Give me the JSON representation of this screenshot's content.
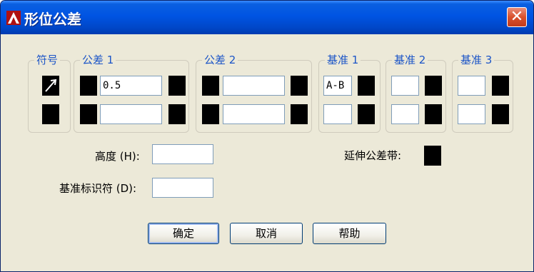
{
  "window": {
    "title": "形位公差",
    "close_glyph": "✕"
  },
  "groups": {
    "symbol": {
      "label": "符号"
    },
    "tol1": {
      "label": "公差 1",
      "row1_value": "0.5",
      "row2_value": ""
    },
    "tol2": {
      "label": "公差 2",
      "row1_value": "",
      "row2_value": ""
    },
    "datum1": {
      "label": "基准 1",
      "row1_value": "A-B",
      "row2_value": ""
    },
    "datum2": {
      "label": "基准 2",
      "row1_value": "",
      "row2_value": ""
    },
    "datum3": {
      "label": "基准 3",
      "row1_value": "",
      "row2_value": ""
    }
  },
  "fields": {
    "height_label": "高度 (H):",
    "height_value": "",
    "datum_id_label": "基准标识符 (D):",
    "datum_id_value": "",
    "projected_zone_label": "延伸公差带:"
  },
  "buttons": {
    "ok": "确定",
    "cancel": "取消",
    "help": "帮助"
  },
  "colors": {
    "title_bar": "#0054e3",
    "group_label": "#1c55c7",
    "dialog_bg": "#ece9d8"
  }
}
